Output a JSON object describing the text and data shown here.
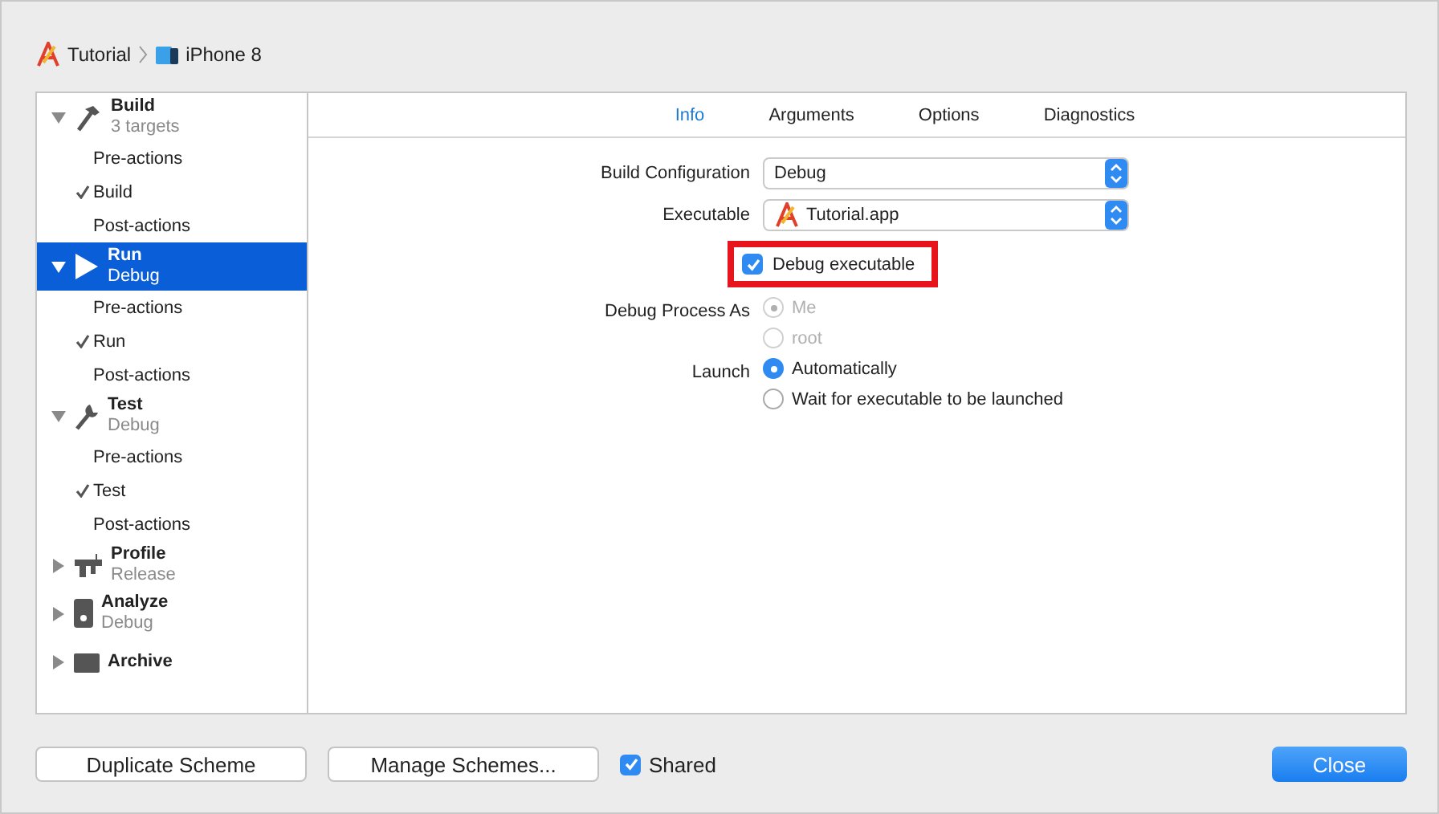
{
  "breadcrumb": [
    {
      "kind": "app",
      "label": "Tutorial"
    },
    {
      "kind": "device",
      "label": "iPhone 8"
    }
  ],
  "sidebar": [
    {
      "kind": "build",
      "title": "Build",
      "subtitle": "3 targets",
      "expanded": true,
      "selected": false,
      "children": [
        {
          "label": "Pre-actions",
          "checked": false
        },
        {
          "label": "Build",
          "checked": true
        },
        {
          "label": "Post-actions",
          "checked": false
        }
      ]
    },
    {
      "kind": "run",
      "title": "Run",
      "subtitle": "Debug",
      "expanded": true,
      "selected": true,
      "children": [
        {
          "label": "Pre-actions",
          "checked": false
        },
        {
          "label": "Run",
          "checked": true
        },
        {
          "label": "Post-actions",
          "checked": false
        }
      ]
    },
    {
      "kind": "test",
      "title": "Test",
      "subtitle": "Debug",
      "expanded": true,
      "selected": false,
      "children": [
        {
          "label": "Pre-actions",
          "checked": false
        },
        {
          "label": "Test",
          "checked": true
        },
        {
          "label": "Post-actions",
          "checked": false
        }
      ]
    },
    {
      "kind": "profile",
      "title": "Profile",
      "subtitle": "Release",
      "expanded": false,
      "selected": false
    },
    {
      "kind": "analyze",
      "title": "Analyze",
      "subtitle": "Debug",
      "expanded": false,
      "selected": false
    },
    {
      "kind": "archive",
      "title": "Archive",
      "expanded": false,
      "selected": false
    }
  ],
  "tabs": [
    {
      "label": "Info",
      "selected": true
    },
    {
      "label": "Arguments",
      "selected": false
    },
    {
      "label": "Options",
      "selected": false
    },
    {
      "label": "Diagnostics",
      "selected": false
    }
  ],
  "form": [
    {
      "kind": "popup",
      "label": "Build Configuration",
      "value": "Debug",
      "icon": false
    },
    {
      "kind": "popup",
      "label": "Executable",
      "value": "Tutorial.app",
      "icon": true
    },
    {
      "kind": "checkbox",
      "text": "Debug executable",
      "checked": true,
      "highlighted": true
    },
    {
      "kind": "radios",
      "label": "Debug Process As",
      "disabled": true,
      "options": [
        {
          "text": "Me",
          "selected": true
        },
        {
          "text": "root",
          "selected": false
        }
      ]
    },
    {
      "kind": "radios",
      "label": "Launch",
      "disabled": false,
      "options": [
        {
          "text": "Automatically",
          "selected": true
        },
        {
          "text": "Wait for executable to be launched",
          "selected": false
        }
      ]
    }
  ],
  "footer": {
    "buttons": [
      "Duplicate Scheme",
      "Manage Schemes..."
    ],
    "shared": {
      "label": "Shared",
      "checked": true
    },
    "close": "Close"
  }
}
